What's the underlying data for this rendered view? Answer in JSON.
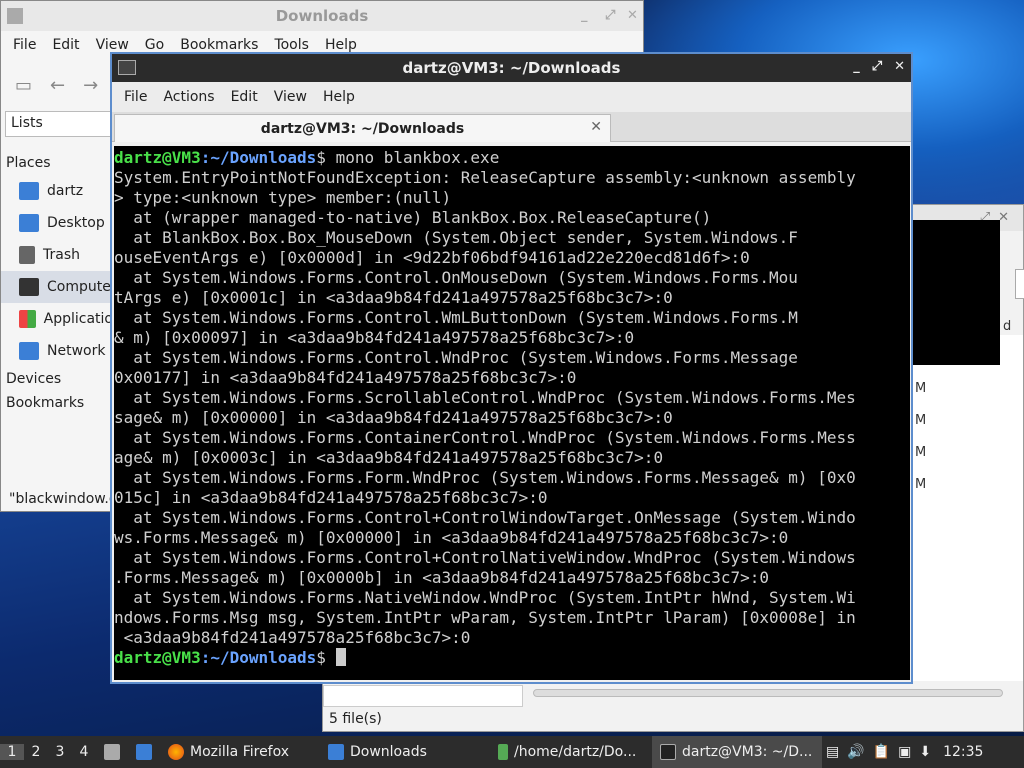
{
  "file_manager": {
    "title": "Downloads",
    "menu": [
      "File",
      "Edit",
      "View",
      "Go",
      "Bookmarks",
      "Tools",
      "Help"
    ],
    "panel_mode": "Lists",
    "places_header": "Places",
    "places": [
      {
        "label": "dartz",
        "icon": "home-folder-icon"
      },
      {
        "label": "Desktop",
        "icon": "desktop-folder-icon"
      },
      {
        "label": "Trash",
        "icon": "trash-icon"
      },
      {
        "label": "Compute",
        "icon": "computer-icon"
      },
      {
        "label": "Applicatio",
        "icon": "applications-icon"
      },
      {
        "label": "Network",
        "icon": "network-icon"
      }
    ],
    "devices_header": "Devices",
    "bookmarks_header": "Bookmarks",
    "status": "\"blackwindow.e"
  },
  "right_window": {
    "status": "5 file(s)",
    "col_fragment": "d",
    "row_fragment": "M"
  },
  "terminal": {
    "title": "dartz@VM3: ~/Downloads",
    "menu": [
      "File",
      "Actions",
      "Edit",
      "View",
      "Help"
    ],
    "tab_label": "dartz@VM3: ~/Downloads",
    "prompt_user": "dartz@VM3",
    "prompt_path": ":~/Downloads",
    "command": "$ mono blankbox.exe",
    "output": [
      "System.EntryPointNotFoundException: ReleaseCapture assembly:<unknown assembly",
      "> type:<unknown type> member:(null)",
      "  at (wrapper managed-to-native) BlankBox.Box.ReleaseCapture()",
      "  at BlankBox.Box.Box_MouseDown (System.Object sender, System.Windows.F",
      "ouseEventArgs e) [0x0000d] in <9d22bf06bdf94161ad22e220ecd81d6f>:0",
      "  at System.Windows.Forms.Control.OnMouseDown (System.Windows.Forms.Mou",
      "tArgs e) [0x0001c] in <a3daa9b84fd241a497578a25f68bc3c7>:0",
      "  at System.Windows.Forms.Control.WmLButtonDown (System.Windows.Forms.M",
      "& m) [0x00097] in <a3daa9b84fd241a497578a25f68bc3c7>:0",
      "  at System.Windows.Forms.Control.WndProc (System.Windows.Forms.Message",
      "0x00177] in <a3daa9b84fd241a497578a25f68bc3c7>:0",
      "  at System.Windows.Forms.ScrollableControl.WndProc (System.Windows.Forms.Mes",
      "sage& m) [0x00000] in <a3daa9b84fd241a497578a25f68bc3c7>:0",
      "  at System.Windows.Forms.ContainerControl.WndProc (System.Windows.Forms.Mess",
      "age& m) [0x0003c] in <a3daa9b84fd241a497578a25f68bc3c7>:0",
      "  at System.Windows.Forms.Form.WndProc (System.Windows.Forms.Message& m) [0x0",
      "015c] in <a3daa9b84fd241a497578a25f68bc3c7>:0",
      "  at System.Windows.Forms.Control+ControlWindowTarget.OnMessage (System.Windo",
      "ws.Forms.Message& m) [0x00000] in <a3daa9b84fd241a497578a25f68bc3c7>:0",
      "  at System.Windows.Forms.Control+ControlNativeWindow.WndProc (System.Windows",
      ".Forms.Message& m) [0x0000b] in <a3daa9b84fd241a497578a25f68bc3c7>:0",
      "  at System.Windows.Forms.NativeWindow.WndProc (System.IntPtr hWnd, System.Wi",
      "ndows.Forms.Msg msg, System.IntPtr wParam, System.IntPtr lParam) [0x0008e] in",
      " <a3daa9b84fd241a497578a25f68bc3c7>:0"
    ],
    "final_prompt": "$ "
  },
  "taskbar": {
    "workspaces": [
      "1",
      "2",
      "3",
      "4"
    ],
    "items": [
      {
        "label": "Mozilla Firefox",
        "icon": "firefox-icon"
      },
      {
        "label": "Downloads",
        "icon": "folder-icon"
      },
      {
        "label": "/home/dartz/Do...",
        "icon": "archive-icon"
      },
      {
        "label": "dartz@VM3: ~/D...",
        "icon": "terminal-icon"
      }
    ],
    "clock": "12:35"
  },
  "colors": {
    "prompt_user": "#49e049",
    "prompt_path": "#6aa3ff",
    "terminal_bg": "#000000",
    "taskbar_bg": "#2c2c2c"
  }
}
